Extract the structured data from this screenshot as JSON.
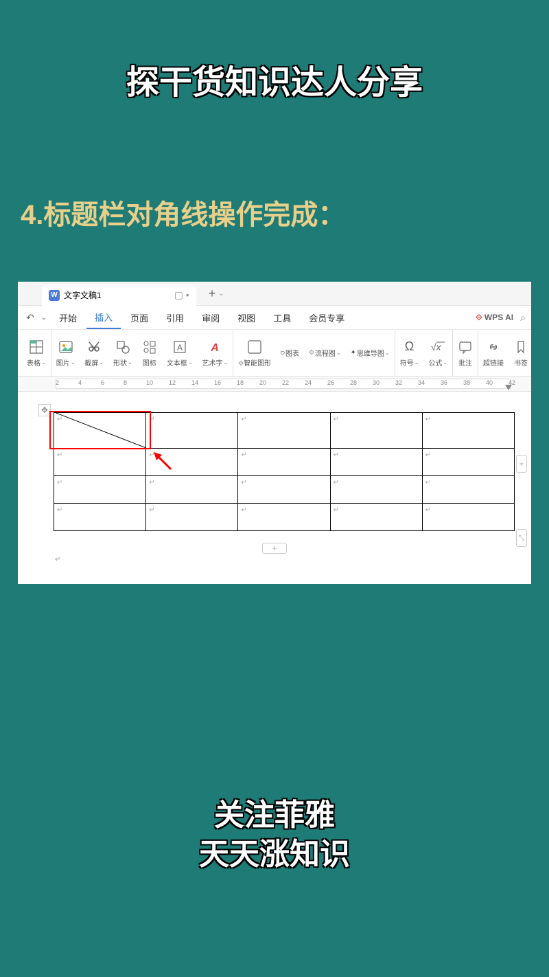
{
  "title": "探干货知识达人分享",
  "step": "4.标题栏对角线操作完成：",
  "tab": {
    "icon": "W",
    "name": "文字文稿1"
  },
  "newtab": "+",
  "menu": [
    "开始",
    "插入",
    "页面",
    "引用",
    "审阅",
    "视图",
    "工具",
    "会员专享"
  ],
  "menu_active_index": 1,
  "wps_ai": "WPS AI",
  "toolbar": [
    {
      "label": "表格",
      "caret": true
    },
    {
      "label": "图片",
      "caret": true
    },
    {
      "label": "截屏",
      "caret": true
    },
    {
      "label": "形状",
      "caret": true
    },
    {
      "label": "图标",
      "caret": false
    },
    {
      "label": "文本框",
      "caret": true
    },
    {
      "label": "艺术字",
      "caret": true
    },
    {
      "label": "智能图形",
      "caret": false,
      "pre": "⟐"
    },
    {
      "label": "图表",
      "caret": false,
      "top": true,
      "icon": "⫐"
    },
    {
      "label": "流程图",
      "caret": true,
      "top": true,
      "icon": "⟐"
    },
    {
      "label": "思维导图",
      "caret": true,
      "top": true,
      "icon": "✦"
    },
    {
      "label": "符号",
      "caret": true
    },
    {
      "label": "公式",
      "caret": true
    },
    {
      "label": "批注",
      "caret": false
    },
    {
      "label": "超链接",
      "caret": false
    },
    {
      "label": "书签",
      "caret": false
    }
  ],
  "ruler_ticks": [
    2,
    4,
    6,
    8,
    10,
    12,
    14,
    16,
    18,
    20,
    22,
    24,
    26,
    28,
    30,
    32,
    34,
    36,
    38,
    40,
    42
  ],
  "cell_mark": "↵",
  "footer_line1": "关注菲雅",
  "footer_line2": "天天涨知识"
}
